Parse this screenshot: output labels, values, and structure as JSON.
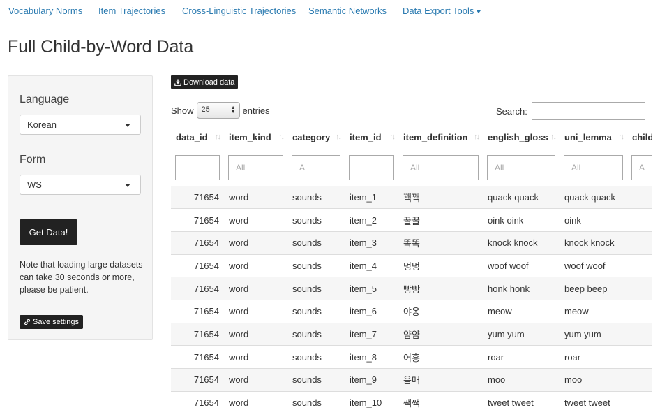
{
  "nav": {
    "items": [
      "Vocabulary Norms",
      "Item Trajectories",
      "Cross-Linguistic Trajectories",
      "Semantic Networks",
      "Data Export Tools"
    ]
  },
  "page_title": "Full Child-by-Word Data",
  "sidebar": {
    "language_label": "Language",
    "language_value": "Korean",
    "form_label": "Form",
    "form_value": "WS",
    "get_data_label": "Get Data!",
    "note": "Note that loading large datasets can take 30 seconds or more, please be patient.",
    "save_settings_label": "Save settings"
  },
  "toolbar": {
    "download_label": "Download data",
    "show_label": "Show",
    "page_length": "25",
    "entries_label": "entries",
    "search_label": "Search:"
  },
  "table": {
    "columns": [
      "data_id",
      "item_kind",
      "category",
      "item_id",
      "item_definition",
      "english_gloss",
      "uni_lemma",
      "child"
    ],
    "filter_placeholders": [
      "",
      "All",
      "A",
      "",
      "All",
      "All",
      "All",
      "A"
    ],
    "rows": [
      [
        "71654",
        "word",
        "sounds",
        "item_1",
        "꽥꽥",
        "quack quack",
        "quack quack",
        ""
      ],
      [
        "71654",
        "word",
        "sounds",
        "item_2",
        "꿀꿀",
        "oink oink",
        "oink",
        ""
      ],
      [
        "71654",
        "word",
        "sounds",
        "item_3",
        "똑똑",
        "knock knock",
        "knock knock",
        ""
      ],
      [
        "71654",
        "word",
        "sounds",
        "item_4",
        "멍멍",
        "woof woof",
        "woof woof",
        ""
      ],
      [
        "71654",
        "word",
        "sounds",
        "item_5",
        "빵빵",
        "honk honk",
        "beep beep",
        ""
      ],
      [
        "71654",
        "word",
        "sounds",
        "item_6",
        "야옹",
        "meow",
        "meow",
        ""
      ],
      [
        "71654",
        "word",
        "sounds",
        "item_7",
        "얌얌",
        "yum yum",
        "yum yum",
        ""
      ],
      [
        "71654",
        "word",
        "sounds",
        "item_8",
        "어흥",
        "roar",
        "roar",
        ""
      ],
      [
        "71654",
        "word",
        "sounds",
        "item_9",
        "음매",
        "moo",
        "moo",
        ""
      ],
      [
        "71654",
        "word",
        "sounds",
        "item_10",
        "짹짹",
        "tweet tweet",
        "tweet tweet",
        ""
      ]
    ]
  }
}
